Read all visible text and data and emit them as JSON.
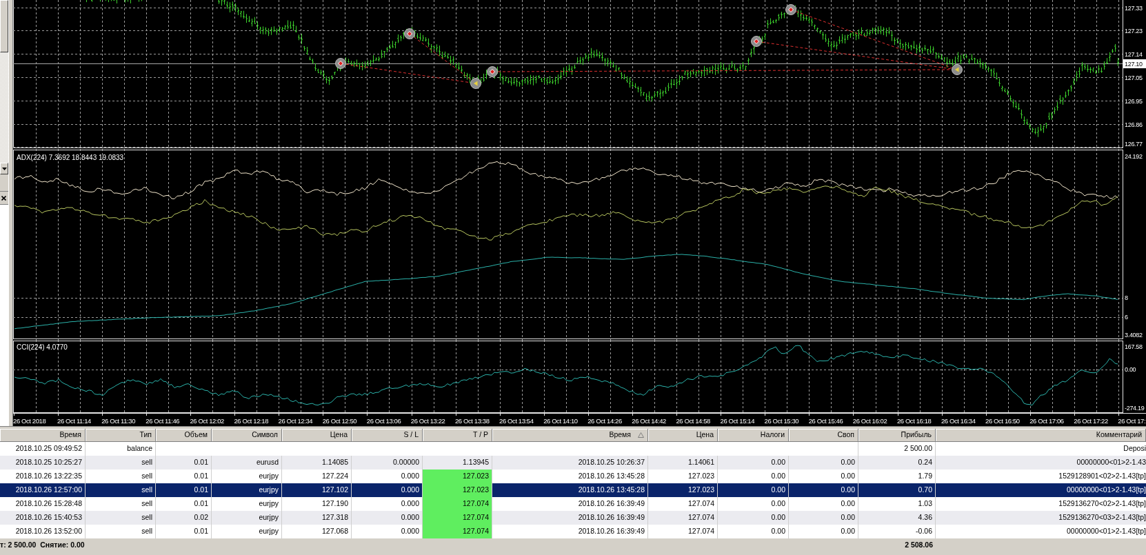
{
  "chart": {
    "price_pane": {
      "price_labels": [
        "127.33",
        "127.23",
        "127.14",
        "127.05",
        "126.95",
        "126.86",
        "126.77"
      ],
      "current_price": "127.10"
    },
    "adx_pane": {
      "legend": "ADX(224) 7.3692 18.8443 19.0833",
      "scale_labels": [
        "24.192",
        "8",
        "6",
        "3.4082"
      ]
    },
    "cci_pane": {
      "legend": "CCI(224) 4.0770",
      "scale_labels": [
        "167.58",
        "0.00",
        "-274.19"
      ]
    },
    "time_labels": [
      "26 Oct 2018",
      "26 Oct 11:14",
      "26 Oct 11:30",
      "26 Oct 11:46",
      "26 Oct 12:02",
      "26 Oct 12:18",
      "26 Oct 12:34",
      "26 Oct 12:50",
      "26 Oct 13:06",
      "26 Oct 13:22",
      "26 Oct 13:38",
      "26 Oct 13:54",
      "26 Oct 14:10",
      "26 Oct 14:26",
      "26 Oct 14:42",
      "26 Oct 14:58",
      "26 Oct 15:14",
      "26 Oct 15:30",
      "26 Oct 15:46",
      "26 Oct 16:02",
      "26 Oct 16:18",
      "26 Oct 16:34",
      "26 Oct 16:50",
      "26 Oct 17:06",
      "26 Oct 17:22",
      "26 Oct 17:"
    ]
  },
  "history": {
    "columns": [
      {
        "label": "Время",
        "sorted": false
      },
      {
        "label": "Тип",
        "sorted": false
      },
      {
        "label": "Объем",
        "sorted": false
      },
      {
        "label": "Символ",
        "sorted": false
      },
      {
        "label": "Цена",
        "sorted": false
      },
      {
        "label": "S / L",
        "sorted": false
      },
      {
        "label": "T / P",
        "sorted": false
      },
      {
        "label": "Время",
        "sorted": true
      },
      {
        "label": "Цена",
        "sorted": false
      },
      {
        "label": "Налоги",
        "sorted": false
      },
      {
        "label": "Своп",
        "sorted": false
      },
      {
        "label": "Прибыль",
        "sorted": false
      },
      {
        "label": "Комментарий",
        "sorted": false
      }
    ],
    "rows": [
      {
        "kind": "balance",
        "open_time": "2018.10.25 09:49:52",
        "type": "balance",
        "profit": "2 500.00",
        "comment": "Deposi",
        "selected": false
      },
      {
        "kind": "trade",
        "open_time": "2018.10.25 10:25:27",
        "type": "sell",
        "volume": "0.01",
        "symbol": "eurusd",
        "open_price": "1.14085",
        "sl": "0.00000",
        "tp": "1.13945",
        "tp_reached": false,
        "close_time": "2018.10.25 10:26:37",
        "close_price": "1.14061",
        "taxes": "0.00",
        "swap": "0.00",
        "profit": "0.24",
        "comment": "00000000<01>2-1.43",
        "selected": false
      },
      {
        "kind": "trade",
        "open_time": "2018.10.26 13:22:35",
        "type": "sell",
        "volume": "0.01",
        "symbol": "eurjpy",
        "open_price": "127.224",
        "sl": "0.000",
        "tp": "127.023",
        "tp_reached": true,
        "close_time": "2018.10.26 13:45:28",
        "close_price": "127.023",
        "taxes": "0.00",
        "swap": "0.00",
        "profit": "1.79",
        "comment": "1529128901<02>2-1.43[tp]",
        "selected": false
      },
      {
        "kind": "trade",
        "open_time": "2018.10.26 12:57:00",
        "type": "sell",
        "volume": "0.01",
        "symbol": "eurjpy",
        "open_price": "127.102",
        "sl": "0.000",
        "tp": "127.023",
        "tp_reached": true,
        "close_time": "2018.10.26 13:45:28",
        "close_price": "127.023",
        "taxes": "0.00",
        "swap": "0.00",
        "profit": "0.70",
        "comment": "00000000<01>2-1.43[tp]",
        "selected": true
      },
      {
        "kind": "trade",
        "open_time": "2018.10.26 15:28:48",
        "type": "sell",
        "volume": "0.01",
        "symbol": "eurjpy",
        "open_price": "127.190",
        "sl": "0.000",
        "tp": "127.074",
        "tp_reached": true,
        "close_time": "2018.10.26 16:39:49",
        "close_price": "127.074",
        "taxes": "0.00",
        "swap": "0.00",
        "profit": "1.03",
        "comment": "1529136270<02>2-1.43[tp]",
        "selected": false
      },
      {
        "kind": "trade",
        "open_time": "2018.10.26 15:40:53",
        "type": "sell",
        "volume": "0.02",
        "symbol": "eurjpy",
        "open_price": "127.318",
        "sl": "0.000",
        "tp": "127.074",
        "tp_reached": true,
        "close_time": "2018.10.26 16:39:49",
        "close_price": "127.074",
        "taxes": "0.00",
        "swap": "0.00",
        "profit": "4.36",
        "comment": "1529136270<03>2-1.43[tp]",
        "selected": false
      },
      {
        "kind": "trade",
        "open_time": "2018.10.26 13:52:00",
        "type": "sell",
        "volume": "0.01",
        "symbol": "eurjpy",
        "open_price": "127.068",
        "sl": "0.000",
        "tp": "127.074",
        "tp_reached": true,
        "close_time": "2018.10.26 16:39:49",
        "close_price": "127.074",
        "taxes": "0.00",
        "swap": "0.00",
        "profit": "-0.06",
        "comment": "00000000<01>2-1.43[tp]",
        "selected": false
      }
    ],
    "summary": {
      "text": "т: 2 500.00  Снятие: 0.00",
      "total": "2 508.06"
    }
  }
}
